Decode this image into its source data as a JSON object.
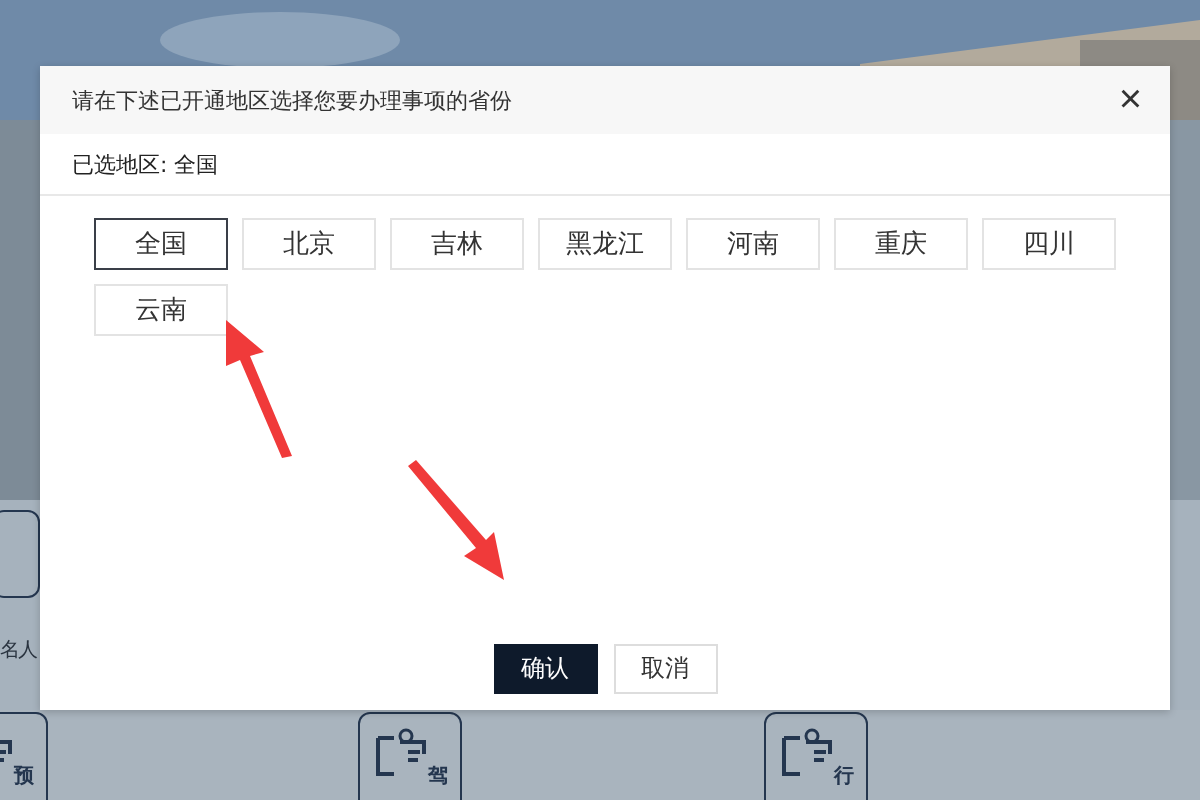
{
  "background": {
    "left_label": "名人",
    "tiles": [
      {
        "glyph": "预"
      },
      {
        "glyph": "驾"
      },
      {
        "glyph": "行"
      }
    ]
  },
  "dialog": {
    "title": "请在下述已开通地区选择您要办理事项的省份",
    "close": "×",
    "selected_label": "已选地区: 全国",
    "regions": [
      {
        "label": "全国",
        "selected": true
      },
      {
        "label": "北京",
        "selected": false
      },
      {
        "label": "吉林",
        "selected": false
      },
      {
        "label": "黑龙江",
        "selected": false
      },
      {
        "label": "河南",
        "selected": false
      },
      {
        "label": "重庆",
        "selected": false
      },
      {
        "label": "四川",
        "selected": false
      },
      {
        "label": "云南",
        "selected": false
      }
    ],
    "buttons": [
      {
        "label": "确认",
        "kind": "primary"
      },
      {
        "label": "取消",
        "kind": "secondary"
      }
    ]
  }
}
